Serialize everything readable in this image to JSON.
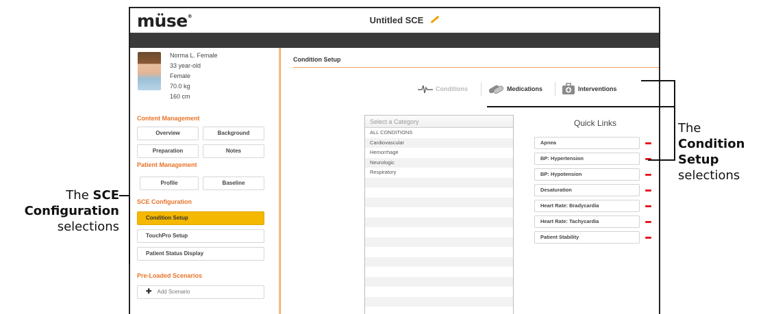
{
  "app": {
    "logo": "müse",
    "logo_mark": "®",
    "title": "Untitled SCE"
  },
  "patient": {
    "name": "Norma L. Female",
    "age": "33 year-old",
    "sex": "Female",
    "weight": "70.0 kg",
    "height": "160 cm"
  },
  "sidebar": {
    "content_management": {
      "heading": "Content Management",
      "buttons": [
        "Overview",
        "Background",
        "Preparation",
        "Notes"
      ]
    },
    "patient_management": {
      "heading": "Patient Management",
      "buttons": [
        "Profile",
        "Baseline"
      ]
    },
    "sce_configuration": {
      "heading": "SCE Configuration",
      "buttons": [
        "Condition Setup",
        "TouchPro Setup",
        "Patient Status Display"
      ],
      "active": "Condition Setup"
    },
    "preloaded": {
      "heading": "Pre-Loaded Scenarios",
      "add_label": "Add Scenario"
    }
  },
  "main": {
    "heading": "Condition Setup",
    "tabs": [
      {
        "label": "Conditions",
        "icon": "ecg-waveform-icon",
        "state": "disabled"
      },
      {
        "label": "Medications",
        "icon": "pills-icon",
        "state": "normal"
      },
      {
        "label": "Interventions",
        "icon": "medkit-icon",
        "state": "normal"
      }
    ],
    "category_select": {
      "placeholder": "Select a Category",
      "items": [
        "ALL CONDITIONS",
        "Cardiovascular",
        "Hemorrhage",
        "Neurologic",
        "Respiratory"
      ]
    },
    "quick_links": {
      "title": "Quick Links",
      "items": [
        "Apnea",
        "BP: Hypertension",
        "BP: Hypotension",
        "Desaturation",
        "Heart Rate: Bradycardia",
        "Heart Rate: Tachycardia",
        "Patient Stability"
      ]
    }
  },
  "annotations": {
    "left": {
      "prefix": "The",
      "bold1": "SCE",
      "bold2": "Configuration",
      "suffix": "selections"
    },
    "right": {
      "prefix": "The",
      "bold1": "Condition",
      "bold2": "Setup",
      "suffix": "selections"
    }
  },
  "colors": {
    "accent_orange": "#e8742a",
    "active_yellow": "#f5b800",
    "remove_red": "#e31b23",
    "dark_bar": "#3a3a3a"
  }
}
